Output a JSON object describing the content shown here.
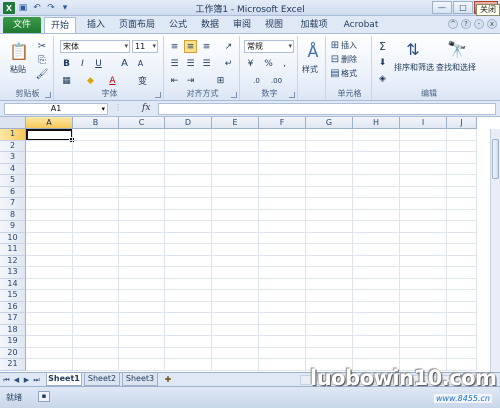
{
  "window": {
    "title": "工作簿1 - Microsoft Excel",
    "controls": {
      "minimize": "—",
      "maximize": "□",
      "close": "✕"
    },
    "tooltip": "关闭"
  },
  "qat": {
    "app_icon": "X",
    "save_icon": "save-icon",
    "undo_icon": "undo-icon",
    "redo_icon": "redo-icon"
  },
  "tabs": [
    {
      "label": "文件"
    },
    {
      "label": "开始"
    },
    {
      "label": "插入"
    },
    {
      "label": "页面布局"
    },
    {
      "label": "公式"
    },
    {
      "label": "数据"
    },
    {
      "label": "审阅"
    },
    {
      "label": "视图"
    },
    {
      "label": "加载项"
    },
    {
      "label": "Acrobat"
    }
  ],
  "ribbon": {
    "clipboard": {
      "paste_label": "粘贴",
      "group_label": "剪贴板"
    },
    "font": {
      "font_name": "宋体",
      "font_size": "11",
      "bold": "B",
      "italic": "I",
      "underline": "U",
      "grow": "A",
      "shrink": "A",
      "wen": "变",
      "group_label": "字体"
    },
    "alignment": {
      "group_label": "对齐方式"
    },
    "number": {
      "format": "常规",
      "percent": "%",
      "comma": ",",
      "group_label": "数字"
    },
    "styles": {
      "styles_label": "样式"
    },
    "cells": {
      "insert": "插入",
      "delete": "删除",
      "format": "格式",
      "group_label": "单元格"
    },
    "editing": {
      "sigma": "Σ",
      "sort_filter": "排序和筛选",
      "find_select": "查找和选择",
      "group_label": "编辑"
    }
  },
  "formula_bar": {
    "name_box": "A1",
    "fx": "fx",
    "value": ""
  },
  "columns": [
    "A",
    "B",
    "C",
    "D",
    "E",
    "F",
    "G",
    "H",
    "I",
    "J"
  ],
  "rows": [
    "1",
    "2",
    "3",
    "4",
    "5",
    "6",
    "7",
    "8",
    "9",
    "10",
    "11",
    "12",
    "13",
    "14",
    "15",
    "16",
    "17",
    "18",
    "19",
    "20",
    "21"
  ],
  "active_cell": "A1",
  "sheets": [
    {
      "label": "Sheet1",
      "active": true
    },
    {
      "label": "Sheet2",
      "active": false
    },
    {
      "label": "Sheet3",
      "active": false
    }
  ],
  "status": {
    "text": "就绪"
  },
  "watermark": {
    "text": "luobowin10.com",
    "sub": "www.8455.cn"
  },
  "colors": {
    "file_tab": "#1f7a30",
    "ribbon_bg": "#e9f0f9",
    "selection": "#f6c75a"
  }
}
